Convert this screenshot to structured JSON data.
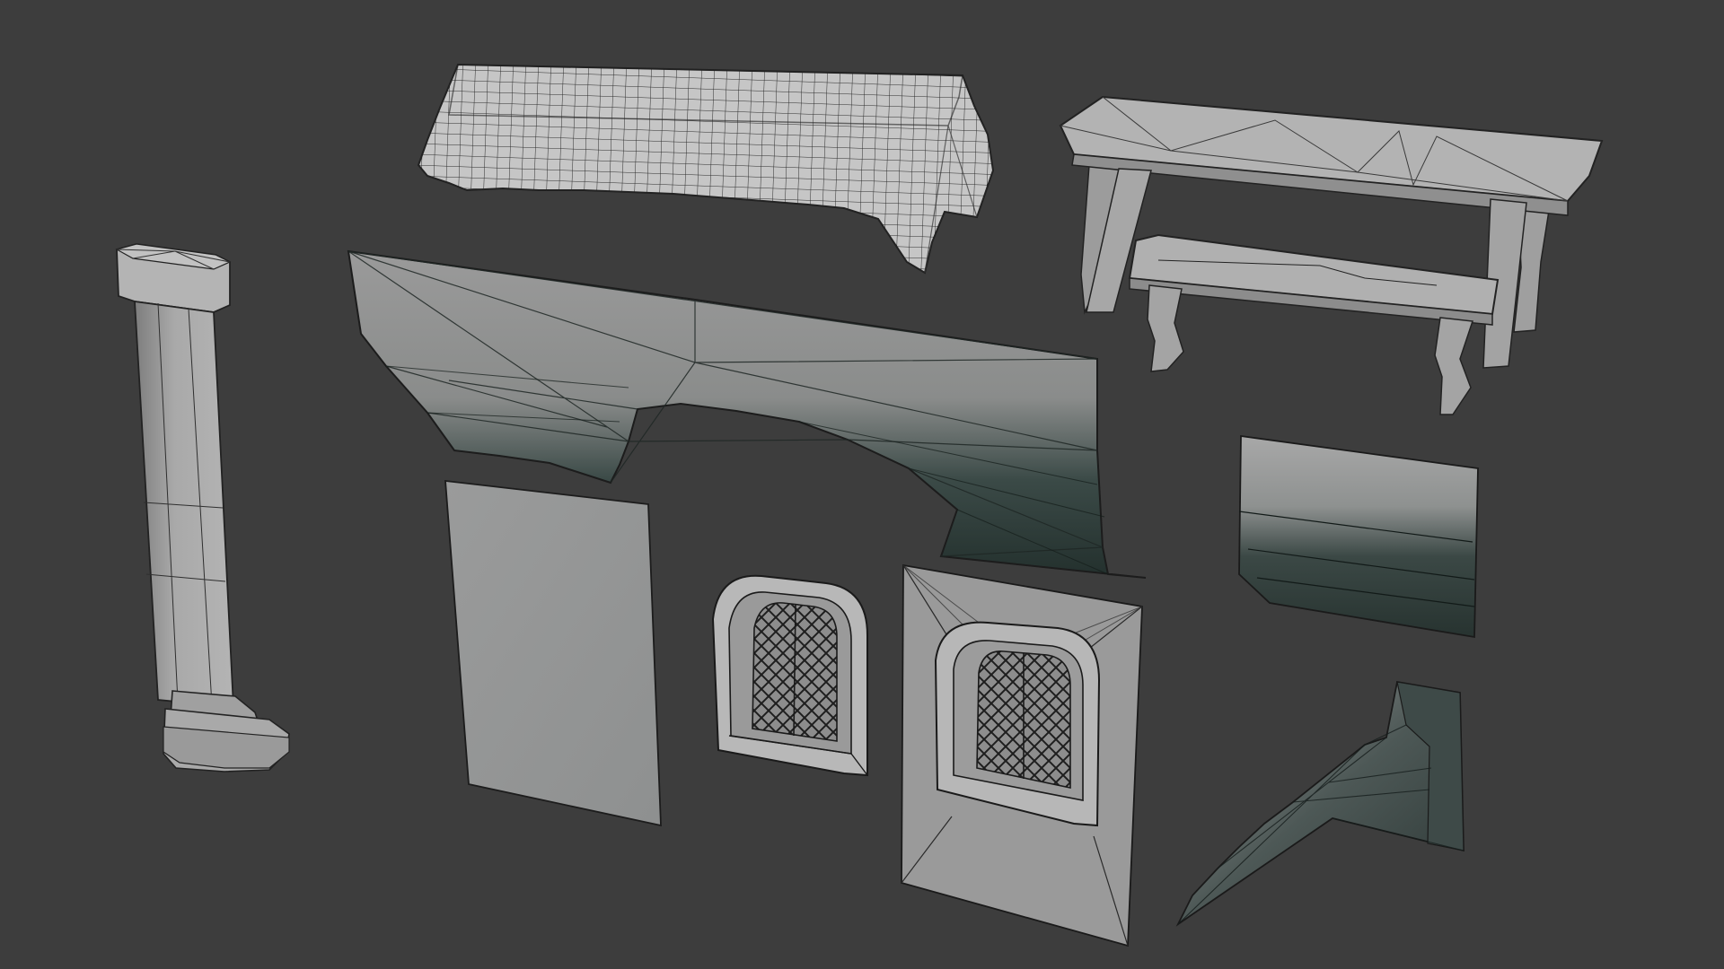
{
  "scene": {
    "background": "#3d3d3d",
    "mesh_fill": "#a9a9a9",
    "wire_color": "#2a2a2a",
    "dark_shade": "#263330",
    "objects": [
      "tablecloth",
      "trestle-table",
      "bench",
      "pillar",
      "stone-arch",
      "wall-panel",
      "arched-window",
      "window-wall-panel",
      "wall-corner-piece",
      "stair-corner-piece"
    ]
  }
}
